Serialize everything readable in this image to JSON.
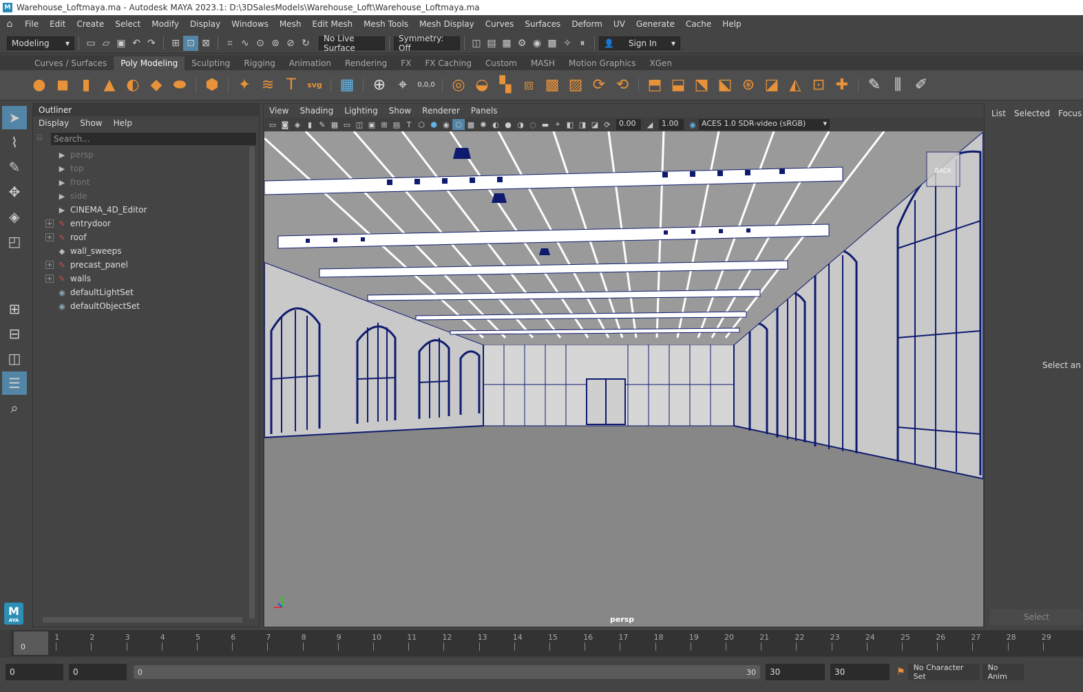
{
  "window": {
    "title": "Warehouse_Loftmaya.ma - Autodesk MAYA 2023.1: D:\\3DSalesModels\\Warehouse_Loft\\Warehouse_Loftmaya.ma"
  },
  "menubar": {
    "items": [
      "File",
      "Edit",
      "Create",
      "Select",
      "Modify",
      "Display",
      "Windows",
      "Mesh",
      "Edit Mesh",
      "Mesh Tools",
      "Mesh Display",
      "Curves",
      "Surfaces",
      "Deform",
      "UV",
      "Generate",
      "Cache",
      "Help"
    ]
  },
  "statusline": {
    "workspace": "Modeling",
    "live_surface": "No Live Surface",
    "symmetry": "Symmetry: Off",
    "sign_in": "Sign In"
  },
  "shelf": {
    "tabs": [
      "Curves / Surfaces",
      "Poly Modeling",
      "Sculpting",
      "Rigging",
      "Animation",
      "Rendering",
      "FX",
      "FX Caching",
      "Custom",
      "MASH",
      "Motion Graphics",
      "XGen"
    ],
    "active_tab": "Poly Modeling",
    "svg_label": "svg",
    "coord_label": "0,0,0"
  },
  "outliner": {
    "title": "Outliner",
    "menu": [
      "Display",
      "Show",
      "Help"
    ],
    "search_placeholder": "Search...",
    "items": [
      {
        "label": "persp",
        "icon": "camera-icon",
        "dim": true,
        "expandable": false
      },
      {
        "label": "top",
        "icon": "camera-icon",
        "dim": true,
        "expandable": false
      },
      {
        "label": "front",
        "icon": "camera-icon",
        "dim": true,
        "expandable": false
      },
      {
        "label": "side",
        "icon": "camera-icon",
        "dim": true,
        "expandable": false
      },
      {
        "label": "CINEMA_4D_Editor",
        "icon": "camera-icon",
        "dim": false,
        "expandable": false
      },
      {
        "label": "entrydoor",
        "icon": "group-icon",
        "dim": false,
        "expandable": true
      },
      {
        "label": "roof",
        "icon": "group-icon",
        "dim": false,
        "expandable": true
      },
      {
        "label": "wall_sweeps",
        "icon": "mesh-icon",
        "dim": false,
        "expandable": false
      },
      {
        "label": "precast_panel",
        "icon": "group-icon",
        "dim": false,
        "expandable": true
      },
      {
        "label": "walls",
        "icon": "group-icon",
        "dim": false,
        "expandable": true
      },
      {
        "label": "defaultLightSet",
        "icon": "set-icon",
        "dim": false,
        "expandable": false
      },
      {
        "label": "defaultObjectSet",
        "icon": "set-icon",
        "dim": false,
        "expandable": false
      }
    ]
  },
  "viewport": {
    "menu": [
      "View",
      "Shading",
      "Lighting",
      "Show",
      "Renderer",
      "Panels"
    ],
    "exposure": "0.00",
    "gamma": "1.00",
    "color_space": "ACES 1.0 SDR-video (sRGB)",
    "camera": "persp",
    "back_label": "BACK"
  },
  "right_panel": {
    "tabs": [
      "List",
      "Selected",
      "Focus"
    ],
    "message": "Select an o",
    "select_button": "Select"
  },
  "timeline": {
    "current_frame": "0",
    "ticks": [
      "0",
      "1",
      "2",
      "3",
      "4",
      "5",
      "6",
      "7",
      "8",
      "9",
      "10",
      "11",
      "12",
      "13",
      "14",
      "15",
      "16",
      "17",
      "18",
      "19",
      "20",
      "21",
      "22",
      "23",
      "24",
      "25",
      "26",
      "27",
      "28",
      "29"
    ]
  },
  "range": {
    "start": "0",
    "anim_start": "0",
    "slider_start": "0",
    "slider_end": "30",
    "anim_end": "30",
    "end": "30",
    "character_set": "No Character Set",
    "anim_layer": "No Anim"
  },
  "colors": {
    "wire": "#0d1a6e",
    "accent": "#5285a6",
    "shelf_icon": "#e8923a"
  }
}
